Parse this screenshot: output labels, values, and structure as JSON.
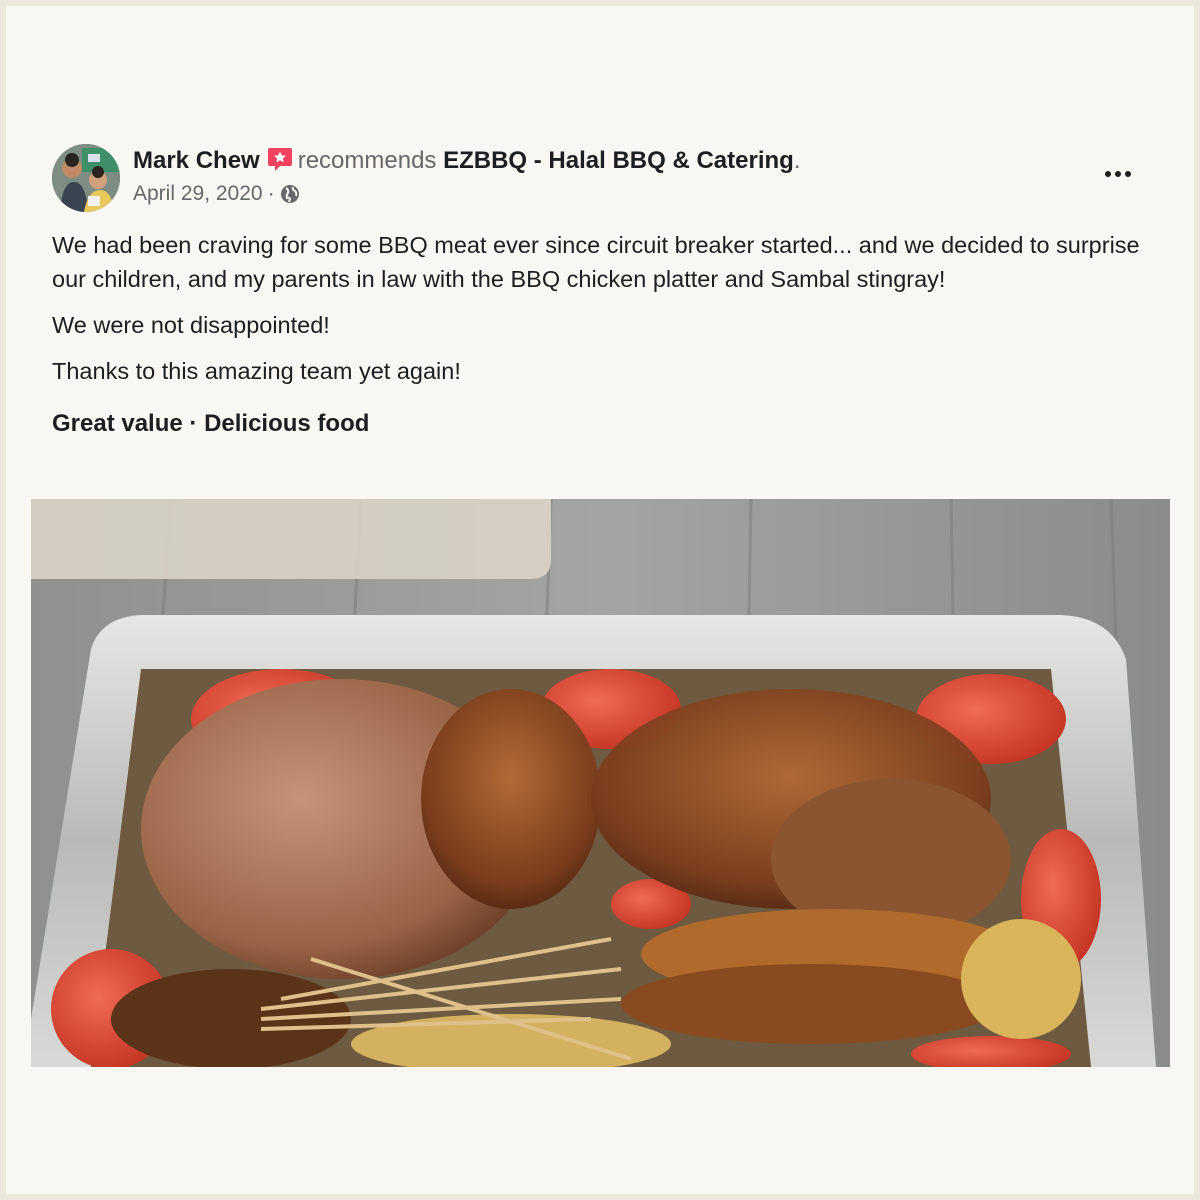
{
  "post": {
    "author": "Mark Chew",
    "verb": "recommends",
    "page_name": "EZBBQ - Halal BBQ & Catering",
    "trailing_dot": ".",
    "date": "April 29, 2020",
    "meta_separator": "·",
    "visibility_icon": "globe-icon",
    "menu_icon": "more-horizontal-icon",
    "paragraphs": [
      "We had been craving for some BBQ meat ever since circuit breaker started... and we decided to surprise our children, and my parents in law with the BBQ chicken platter and Sambal stingray!",
      "We were not disappointed!",
      "Thanks to this amazing team yet again!"
    ],
    "tags": "Great value · Delicious food",
    "colors": {
      "recommend_badge": "#f3425f",
      "secondary_text": "#65676b",
      "primary_text": "#1c1e21"
    }
  }
}
